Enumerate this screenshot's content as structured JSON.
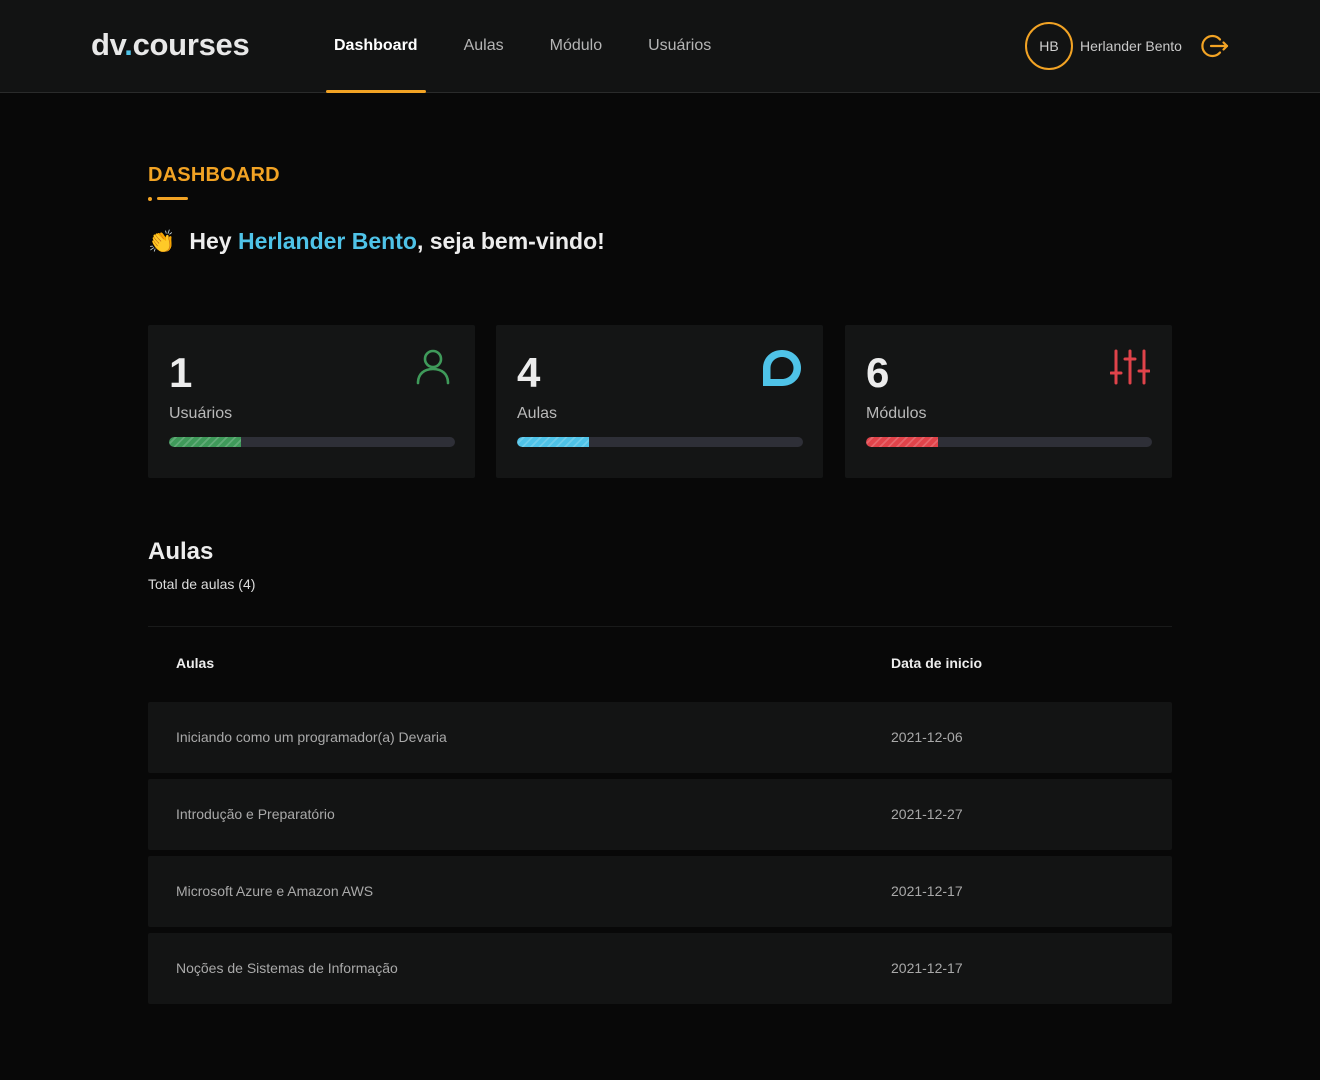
{
  "header": {
    "logo_prefix": "dv",
    "logo_dot": ".",
    "logo_suffix": "courses",
    "nav": [
      "Dashboard",
      "Aulas",
      "Módulo",
      "Usuários"
    ],
    "active_nav": "Dashboard",
    "user_initials": "HB",
    "user_name": "Herlander Bento",
    "accent_color": "#f2a324",
    "logout_icon": "logout-icon"
  },
  "page": {
    "title": "DASHBOARD",
    "greeting_prefix": "Hey ",
    "greeting_name": "Herlander Bento",
    "greeting_suffix": ", seja bem-vindo!",
    "greeting_emoji": "👏"
  },
  "cards": [
    {
      "value": "1",
      "label": "Usuários",
      "icon": "user-icon",
      "color": "#3f9a5a",
      "progress": 0.25
    },
    {
      "value": "4",
      "label": "Aulas",
      "icon": "chat-bubble-icon",
      "color": "#4fc3e8",
      "progress": 0.25
    },
    {
      "value": "6",
      "label": "Módulos",
      "icon": "sliders-icon",
      "color": "#e0434a",
      "progress": 0.25
    }
  ],
  "aulas": {
    "title": "Aulas",
    "subtitle": "Total de aulas (4)",
    "columns": [
      "Aulas",
      "Data de inicio"
    ],
    "rows": [
      {
        "name": "Iniciando como um programador(a) Devaria",
        "date": "2021-12-06"
      },
      {
        "name": "Introdução e Preparatório",
        "date": "2021-12-27"
      },
      {
        "name": "Microsoft Azure e Amazon AWS",
        "date": "2021-12-17"
      },
      {
        "name": "Noções de Sistemas de Informação",
        "date": "2021-12-17"
      }
    ]
  }
}
